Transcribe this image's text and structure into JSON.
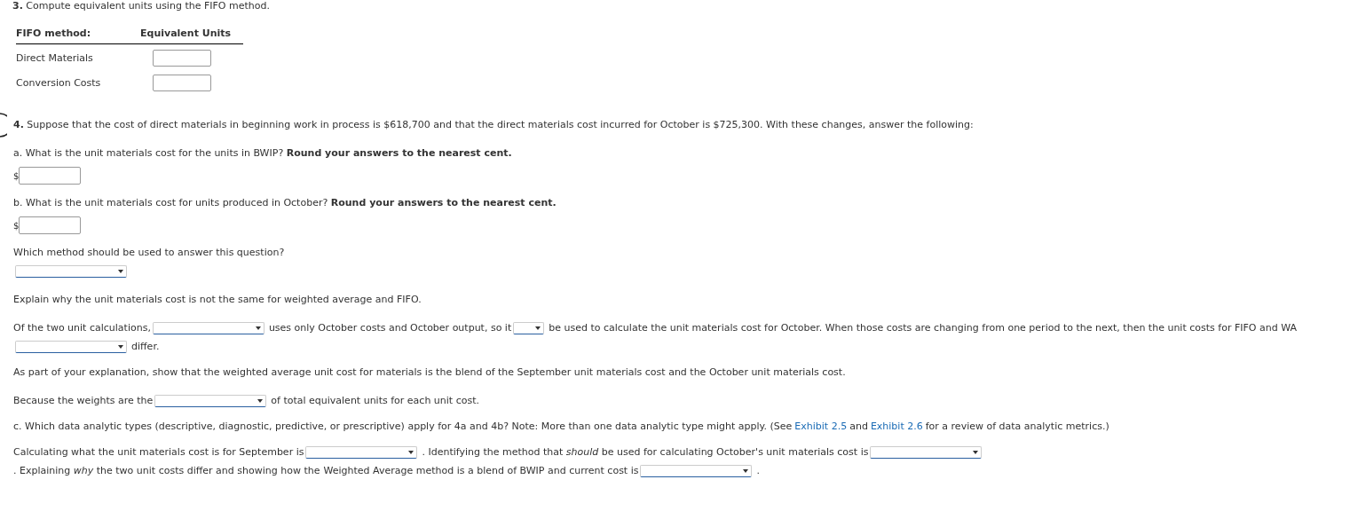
{
  "question_3": {
    "heading": "**3.** Compute equivalent units using the FIFO method.",
    "table": {
      "columns": [
        "FIFO method:",
        "Equivalent Units"
      ],
      "rows": [
        {
          "label": "Direct Materials"
        },
        {
          "label": "Conversion Costs"
        }
      ]
    }
  },
  "question_4": {
    "blocks": [
      {
        "kind": "text",
        "text": "**4.** Suppose that the cost of direct materials in beginning work in process is $618,700 and that the direct materials cost incurred for October is $725,300. With these changes, answer the following:"
      },
      {
        "kind": "text",
        "text": "a. What is the unit materials cost for the units in BWIP? **Round your answers to the nearest cent.**"
      },
      {
        "kind": "answer",
        "currency": "$"
      },
      {
        "kind": "text",
        "text": "b. What is the unit materials cost for units produced in October? **Round your answers to the nearest cent.**"
      },
      {
        "kind": "answer",
        "currency": "$"
      },
      {
        "kind": "text",
        "text": "Which method should be used to answer this question?"
      },
      {
        "kind": "select"
      },
      {
        "kind": "text",
        "text": "Explain why the unit materials cost is not the same for weighted average and FIFO."
      },
      {
        "kind": "sentence",
        "segments": [
          {
            "kind": "text",
            "text": "Of the two unit calculations,"
          },
          {
            "kind": "select"
          },
          {
            "kind": "text",
            "text": "uses only October costs and October output, so it"
          },
          {
            "kind": "short-select"
          },
          {
            "kind": "text",
            "text": "be used to calculate the unit materials cost for October. When those costs are changing from one period to the next, then the unit costs for FIFO and WA"
          },
          {
            "kind": "select"
          },
          {
            "kind": "text",
            "text": "differ."
          }
        ]
      },
      {
        "kind": "text",
        "text": "As part of your explanation, show that the weighted average unit cost for materials is the blend of the September unit materials cost and the October unit materials cost."
      },
      {
        "kind": "sentence",
        "segments": [
          {
            "kind": "text",
            "text": "Because the weights are the"
          },
          {
            "kind": "select"
          },
          {
            "kind": "text",
            "text": "of total equivalent units for each unit cost."
          }
        ]
      },
      {
        "kind": "sentence",
        "segments": [
          {
            "kind": "text",
            "text": "c. Which data analytic types (descriptive, diagnostic, predictive, or prescriptive) apply for 4a and 4b? Note: More than one data analytic type might apply. (See"
          },
          {
            "kind": "link",
            "text": "Exhibit 2.5"
          },
          {
            "kind": "text",
            "text": "and"
          },
          {
            "kind": "link",
            "text": "Exhibit 2.6"
          },
          {
            "kind": "text",
            "text": "for a review of data analytic metrics.)"
          }
        ]
      },
      {
        "kind": "sentence",
        "segments": [
          {
            "kind": "text",
            "text": "Calculating what the unit materials cost is for September is"
          },
          {
            "kind": "select"
          },
          {
            "kind": "text",
            "text": ". Identifying the method that *should* be used for calculating October's unit materials cost is"
          },
          {
            "kind": "select"
          },
          {
            "kind": "text",
            "text": ". Explaining *why* the two unit costs differ and showing how the"
          },
          {
            "kind": "text",
            "text": "Weighted Average method is a blend of BWIP and current cost is"
          },
          {
            "kind": "select"
          },
          {
            "kind": "text",
            "text": "."
          }
        ]
      }
    ]
  }
}
